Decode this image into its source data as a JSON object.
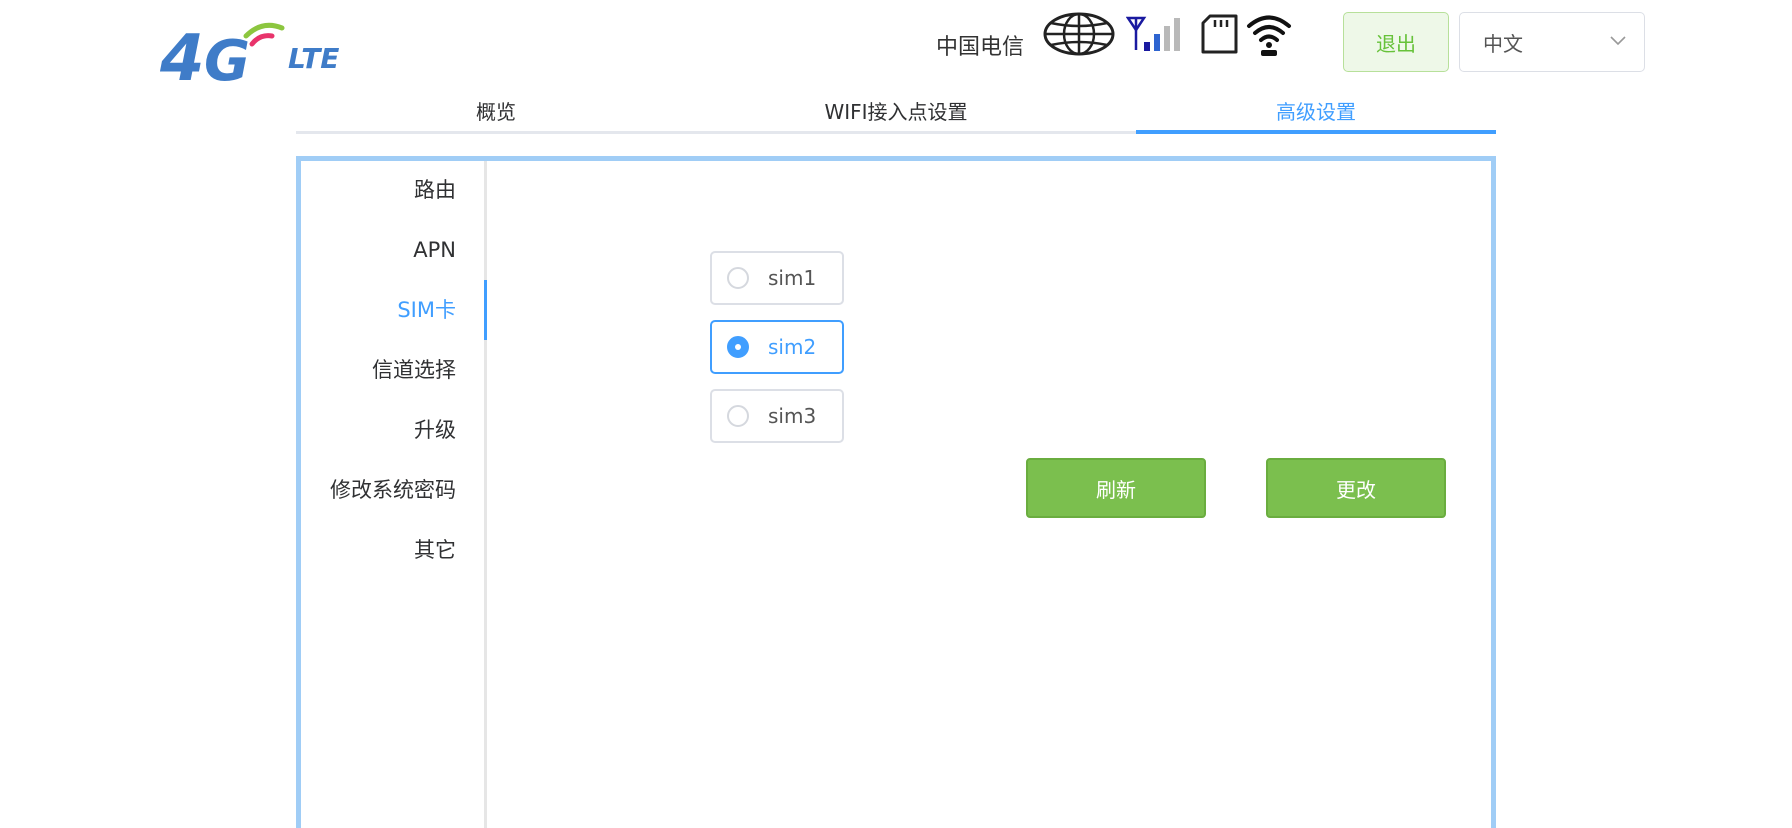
{
  "header": {
    "logo_text": "4G LTE",
    "carrier": "中国电信",
    "icons": [
      "globe-icon",
      "signal-icon",
      "sd-card-icon",
      "wifi-icon"
    ],
    "logout_label": "退出",
    "language_selected": "中文"
  },
  "tabs": [
    {
      "label": "概览"
    },
    {
      "label": "WIFI接入点设置"
    },
    {
      "label": "高级设置"
    }
  ],
  "active_tab": "高级设置",
  "sidebar": {
    "items": [
      {
        "label": "路由"
      },
      {
        "label": "APN"
      },
      {
        "label": "SIM卡"
      },
      {
        "label": "信道选择"
      },
      {
        "label": "升级"
      },
      {
        "label": "修改系统密码"
      },
      {
        "label": "其它"
      }
    ],
    "active": "SIM卡"
  },
  "sim": {
    "options": [
      {
        "label": "sim1",
        "checked": false
      },
      {
        "label": "sim2",
        "checked": true
      },
      {
        "label": "sim3",
        "checked": false
      }
    ],
    "refresh_label": "刷新",
    "change_label": "更改"
  },
  "colors": {
    "accent": "#409eff",
    "panel_border": "#a0cdf6",
    "button_green": "#7bbf4e",
    "logo_blue": "#3f7cc8",
    "logo_green": "#8cc63f",
    "logo_red": "#e8336b"
  }
}
